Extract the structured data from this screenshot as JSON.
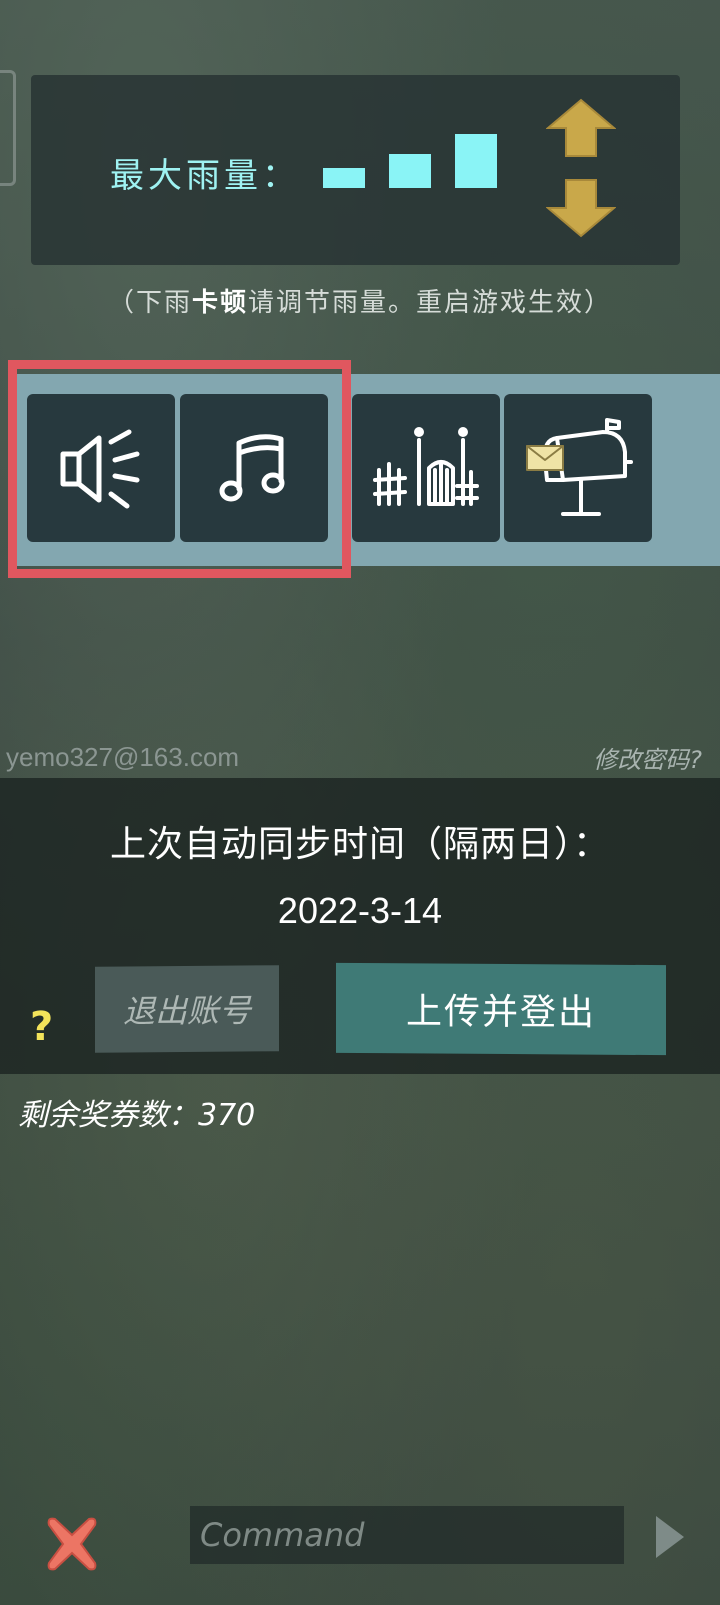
{
  "rain": {
    "label": "最大雨量：",
    "level": 3,
    "max_level": 3,
    "colors": {
      "label": "#9ff2f2",
      "bar": "#8af4f6",
      "arrow": "#c9a84a"
    }
  },
  "hint": {
    "prefix": "（下雨",
    "emphasis": "卡顿",
    "suffix": "请调节雨量。重启游戏生效）"
  },
  "toolbar": {
    "items": [
      {
        "icon": "speaker-icon",
        "highlighted": true
      },
      {
        "icon": "music-note-icon",
        "highlighted": true
      },
      {
        "icon": "fence-gate-icon",
        "highlighted": false
      },
      {
        "icon": "mailbox-icon",
        "highlighted": false
      }
    ],
    "highlight_color": "#e0575f",
    "band_color": "#83a7b0"
  },
  "account": {
    "email": "yemo327@163.com",
    "change_password": "修改密码?"
  },
  "sync": {
    "title": "上次自动同步时间（隔两日）：",
    "date": "2022-3-14",
    "logout_label": "退出账号",
    "upload_label": "上传并登出",
    "help": "?"
  },
  "tickets": {
    "text": "剩余奖券数：370"
  },
  "console": {
    "placeholder": "Command",
    "close_icon": "close-icon",
    "send_icon": "play-arrow-icon"
  }
}
